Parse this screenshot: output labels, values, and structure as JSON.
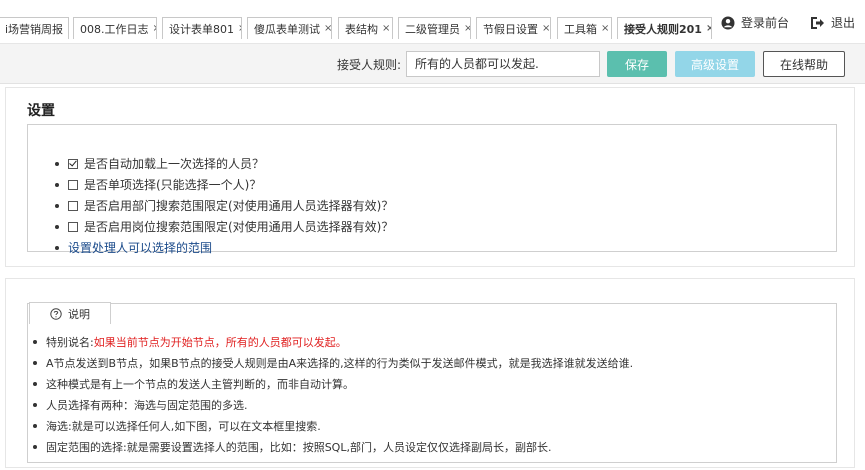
{
  "tabs": [
    {
      "label": "i场营销周报",
      "active": false
    },
    {
      "label": "008.工作日志",
      "active": false
    },
    {
      "label": "设计表单801",
      "active": false
    },
    {
      "label": "傻瓜表单测试",
      "active": false
    },
    {
      "label": "表结构",
      "active": false
    },
    {
      "label": "二级管理员",
      "active": false
    },
    {
      "label": "节假日设置",
      "active": false
    },
    {
      "label": "工具箱",
      "active": false
    },
    {
      "label": "接受人规则201",
      "active": true
    }
  ],
  "tab_close_glyph": "×",
  "header": {
    "login_front": "登录前台",
    "logout": "退出"
  },
  "toolbar": {
    "rule_label": "接受人规则:",
    "rule_value": "所有的人员都可以发起.",
    "save": "保存",
    "advanced": "高级设置",
    "help": "在线帮助"
  },
  "settings": {
    "title": "设置",
    "options": [
      {
        "label": "是否自动加载上一次选择的人员？",
        "checked": true
      },
      {
        "label": "是否单项选择(只能选择一个人)？",
        "checked": false
      },
      {
        "label": "是否启用部门搜索范围限定(对使用通用人员选择器有效)？",
        "checked": false
      },
      {
        "label": "是否启用岗位搜索范围限定(对使用通用人员选择器有效)？",
        "checked": false
      }
    ],
    "range_link": "设置处理人可以选择的范围"
  },
  "description": {
    "tab_label": "说明",
    "special_prefix": "特别说名: ",
    "special_red": "如果当前节点为开始节点，所有的人员都可以发起。",
    "items": [
      "A节点发送到B节点，如果B节点的接受人规则是由A来选择的,这样的行为类似于发送邮件模式，就是我选择谁就发送给谁.",
      "这种模式是有上一个节点的发送人主管判断的，而非自动计算。",
      "人员选择有两种：海选与固定范围的多选.",
      "海选:就是可以选择任何人,如下图，可以在文本框里搜索.",
      "固定范围的选择:就是需要设置选择人的范围，比如：按照SQL,部门，人员设定仅仅选择副局长，副部长."
    ]
  },
  "colors": {
    "save_button": "#5bbfae",
    "advanced_button": "#93d6e8",
    "warning_text": "#e02020",
    "link_text": "#1a4a8a"
  }
}
